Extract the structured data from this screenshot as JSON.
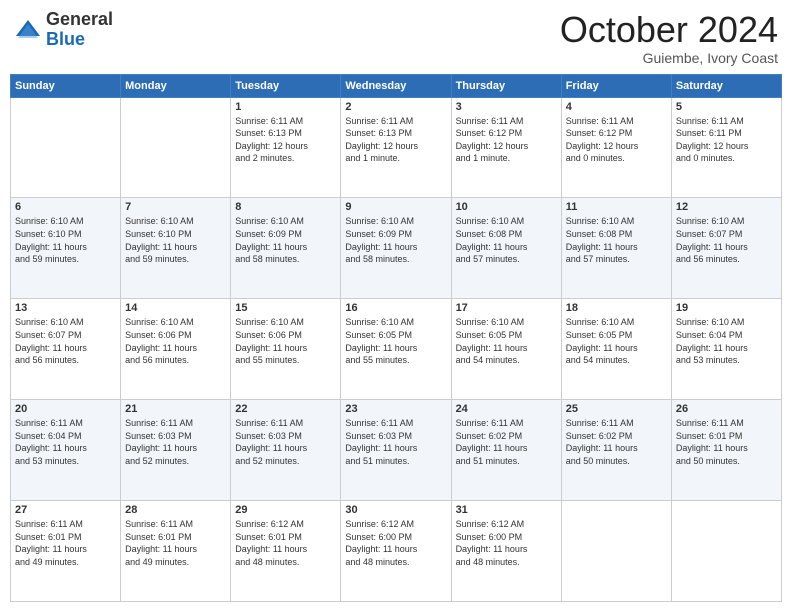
{
  "header": {
    "logo_general": "General",
    "logo_blue": "Blue",
    "month_title": "October 2024",
    "location": "Guiembe, Ivory Coast"
  },
  "days_of_week": [
    "Sunday",
    "Monday",
    "Tuesday",
    "Wednesday",
    "Thursday",
    "Friday",
    "Saturday"
  ],
  "weeks": [
    [
      {
        "day": "",
        "info": ""
      },
      {
        "day": "",
        "info": ""
      },
      {
        "day": "1",
        "info": "Sunrise: 6:11 AM\nSunset: 6:13 PM\nDaylight: 12 hours\nand 2 minutes."
      },
      {
        "day": "2",
        "info": "Sunrise: 6:11 AM\nSunset: 6:13 PM\nDaylight: 12 hours\nand 1 minute."
      },
      {
        "day": "3",
        "info": "Sunrise: 6:11 AM\nSunset: 6:12 PM\nDaylight: 12 hours\nand 1 minute."
      },
      {
        "day": "4",
        "info": "Sunrise: 6:11 AM\nSunset: 6:12 PM\nDaylight: 12 hours\nand 0 minutes."
      },
      {
        "day": "5",
        "info": "Sunrise: 6:11 AM\nSunset: 6:11 PM\nDaylight: 12 hours\nand 0 minutes."
      }
    ],
    [
      {
        "day": "6",
        "info": "Sunrise: 6:10 AM\nSunset: 6:10 PM\nDaylight: 11 hours\nand 59 minutes."
      },
      {
        "day": "7",
        "info": "Sunrise: 6:10 AM\nSunset: 6:10 PM\nDaylight: 11 hours\nand 59 minutes."
      },
      {
        "day": "8",
        "info": "Sunrise: 6:10 AM\nSunset: 6:09 PM\nDaylight: 11 hours\nand 58 minutes."
      },
      {
        "day": "9",
        "info": "Sunrise: 6:10 AM\nSunset: 6:09 PM\nDaylight: 11 hours\nand 58 minutes."
      },
      {
        "day": "10",
        "info": "Sunrise: 6:10 AM\nSunset: 6:08 PM\nDaylight: 11 hours\nand 57 minutes."
      },
      {
        "day": "11",
        "info": "Sunrise: 6:10 AM\nSunset: 6:08 PM\nDaylight: 11 hours\nand 57 minutes."
      },
      {
        "day": "12",
        "info": "Sunrise: 6:10 AM\nSunset: 6:07 PM\nDaylight: 11 hours\nand 56 minutes."
      }
    ],
    [
      {
        "day": "13",
        "info": "Sunrise: 6:10 AM\nSunset: 6:07 PM\nDaylight: 11 hours\nand 56 minutes."
      },
      {
        "day": "14",
        "info": "Sunrise: 6:10 AM\nSunset: 6:06 PM\nDaylight: 11 hours\nand 56 minutes."
      },
      {
        "day": "15",
        "info": "Sunrise: 6:10 AM\nSunset: 6:06 PM\nDaylight: 11 hours\nand 55 minutes."
      },
      {
        "day": "16",
        "info": "Sunrise: 6:10 AM\nSunset: 6:05 PM\nDaylight: 11 hours\nand 55 minutes."
      },
      {
        "day": "17",
        "info": "Sunrise: 6:10 AM\nSunset: 6:05 PM\nDaylight: 11 hours\nand 54 minutes."
      },
      {
        "day": "18",
        "info": "Sunrise: 6:10 AM\nSunset: 6:05 PM\nDaylight: 11 hours\nand 54 minutes."
      },
      {
        "day": "19",
        "info": "Sunrise: 6:10 AM\nSunset: 6:04 PM\nDaylight: 11 hours\nand 53 minutes."
      }
    ],
    [
      {
        "day": "20",
        "info": "Sunrise: 6:11 AM\nSunset: 6:04 PM\nDaylight: 11 hours\nand 53 minutes."
      },
      {
        "day": "21",
        "info": "Sunrise: 6:11 AM\nSunset: 6:03 PM\nDaylight: 11 hours\nand 52 minutes."
      },
      {
        "day": "22",
        "info": "Sunrise: 6:11 AM\nSunset: 6:03 PM\nDaylight: 11 hours\nand 52 minutes."
      },
      {
        "day": "23",
        "info": "Sunrise: 6:11 AM\nSunset: 6:03 PM\nDaylight: 11 hours\nand 51 minutes."
      },
      {
        "day": "24",
        "info": "Sunrise: 6:11 AM\nSunset: 6:02 PM\nDaylight: 11 hours\nand 51 minutes."
      },
      {
        "day": "25",
        "info": "Sunrise: 6:11 AM\nSunset: 6:02 PM\nDaylight: 11 hours\nand 50 minutes."
      },
      {
        "day": "26",
        "info": "Sunrise: 6:11 AM\nSunset: 6:01 PM\nDaylight: 11 hours\nand 50 minutes."
      }
    ],
    [
      {
        "day": "27",
        "info": "Sunrise: 6:11 AM\nSunset: 6:01 PM\nDaylight: 11 hours\nand 49 minutes."
      },
      {
        "day": "28",
        "info": "Sunrise: 6:11 AM\nSunset: 6:01 PM\nDaylight: 11 hours\nand 49 minutes."
      },
      {
        "day": "29",
        "info": "Sunrise: 6:12 AM\nSunset: 6:01 PM\nDaylight: 11 hours\nand 48 minutes."
      },
      {
        "day": "30",
        "info": "Sunrise: 6:12 AM\nSunset: 6:00 PM\nDaylight: 11 hours\nand 48 minutes."
      },
      {
        "day": "31",
        "info": "Sunrise: 6:12 AM\nSunset: 6:00 PM\nDaylight: 11 hours\nand 48 minutes."
      },
      {
        "day": "",
        "info": ""
      },
      {
        "day": "",
        "info": ""
      }
    ]
  ]
}
